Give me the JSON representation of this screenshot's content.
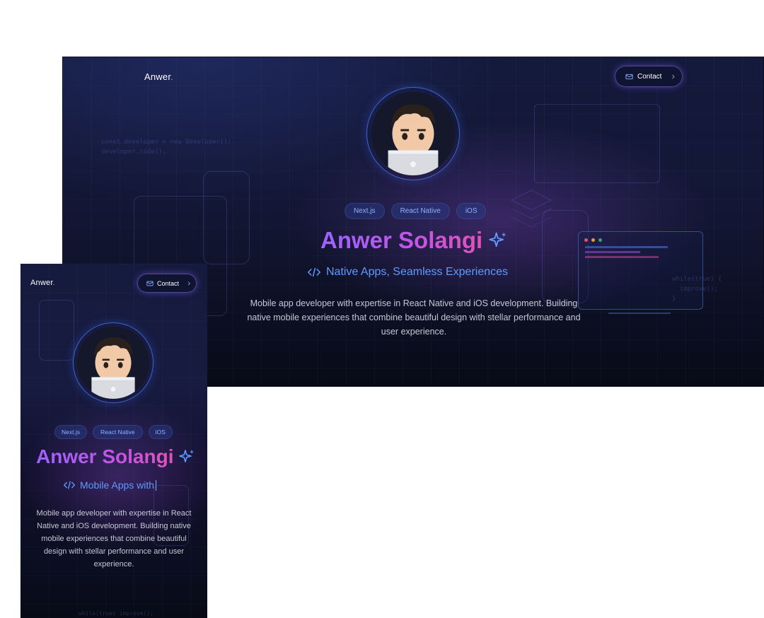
{
  "desktop": {
    "logo": "Anwer",
    "logo_dot": ".",
    "contact_label": "Contact",
    "tags": [
      "Next.js",
      "React Native",
      "iOS"
    ],
    "name": "Anwer Solangi",
    "subtitle": "Native Apps, Seamless Experiences",
    "description": "Mobile app developer with expertise in React Native and iOS development. Building native mobile experiences that combine beautiful design with stellar performance and user experience.",
    "code_left": "const developer = new Developer();\ndeveloper.code();",
    "code_right": "while(true) {\n  improve();\n}"
  },
  "mobile": {
    "logo": "Anwer",
    "logo_dot": ".",
    "contact_label": "Contact",
    "tags": [
      "Next.js",
      "React Native",
      "iOS"
    ],
    "name": "Anwer Solangi",
    "subtitle": "Mobile Apps with",
    "description": "Mobile app developer with expertise in React Native and iOS development. Building native mobile experiences that combine beautiful design with stellar performance and user experience.",
    "code_bottom": "while(true) improve();"
  },
  "icons": {
    "contact": "mail-icon",
    "chevron": "chevron-right-icon",
    "sparkle": "sparkles-icon",
    "code": "code-icon"
  },
  "colors": {
    "name_gradient_start": "#9b63ff",
    "name_gradient_end": "#e052b8",
    "subtitle": "#5f9bff",
    "tag_text": "#8fb2ff",
    "background": "#131735"
  }
}
